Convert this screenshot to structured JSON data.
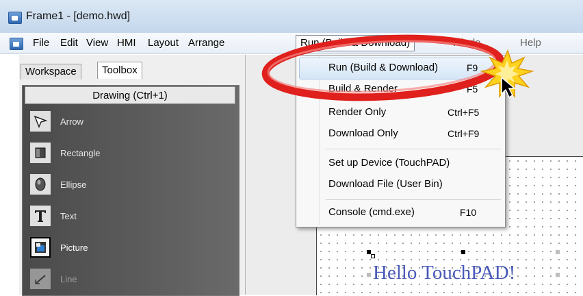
{
  "window": {
    "title": "Frame1 - [demo.hwd]"
  },
  "menubar": {
    "items": [
      "File",
      "Edit",
      "View",
      "HMI",
      "Layout",
      "Arrange",
      "Run (Build & Download)",
      "Windo",
      "Help"
    ]
  },
  "panel": {
    "tabs": [
      "Workspace",
      "Toolbox"
    ],
    "group_header": "Drawing (Ctrl+1)",
    "tools": [
      {
        "label": "Arrow",
        "icon": "arrow-pointer-icon"
      },
      {
        "label": "Rectangle",
        "icon": "rectangle-icon"
      },
      {
        "label": "Ellipse",
        "icon": "ellipse-icon"
      },
      {
        "label": "Text",
        "icon": "text-t-icon"
      },
      {
        "label": "Picture",
        "icon": "picture-icon"
      },
      {
        "label": "Line",
        "icon": "line-icon"
      }
    ]
  },
  "dropdown": {
    "items": [
      {
        "label": "Run (Build & Download)",
        "shortcut": "F9"
      },
      {
        "label": "Build & Render",
        "shortcut": "F5"
      },
      {
        "label": "Render Only",
        "shortcut": "Ctrl+F5"
      },
      {
        "label": "Download Only",
        "shortcut": "Ctrl+F9"
      },
      {
        "label": "Set up Device (TouchPAD)",
        "shortcut": ""
      },
      {
        "label": "Download File (User Bin)",
        "shortcut": ""
      },
      {
        "label": "Console (cmd.exe)",
        "shortcut": "F10"
      }
    ]
  },
  "canvas": {
    "text": "Hello TouchPAD!"
  },
  "colors": {
    "highlight_ellipse": "#e0201c",
    "starburst": "#ffd21f",
    "canvas_text": "#4a5ab8"
  }
}
